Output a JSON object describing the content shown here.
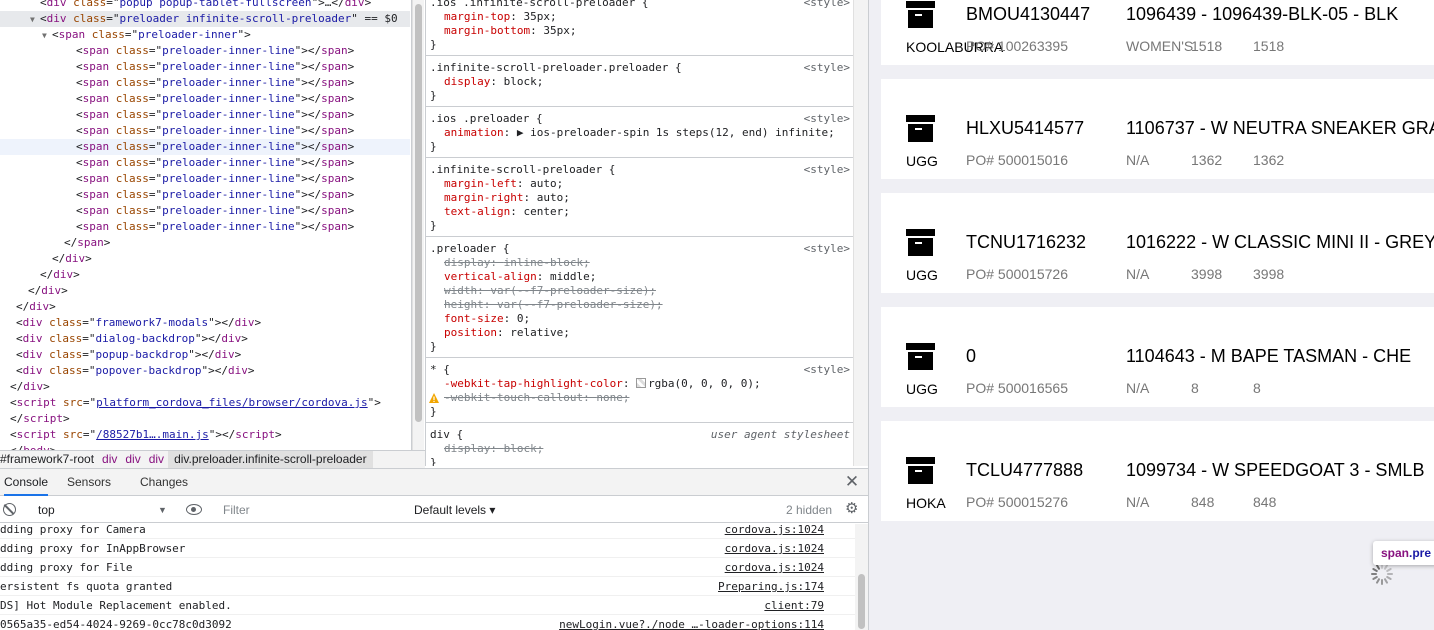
{
  "dom_tree": [
    {
      "indent": 40,
      "tri": "",
      "parts": [
        [
          "tx",
          "<"
        ],
        [
          "tg",
          "div"
        ],
        [
          "tx",
          " "
        ],
        [
          "an",
          "class"
        ],
        [
          "tx",
          "=\""
        ],
        [
          "av",
          "popup popup-tablet-fullscreen"
        ],
        [
          "tx",
          "\">…</"
        ],
        [
          "tg",
          "div"
        ],
        [
          "tx",
          ">"
        ]
      ]
    },
    {
      "indent": 40,
      "tri": "▼",
      "selected": true,
      "parts": [
        [
          "tx",
          "<"
        ],
        [
          "tg",
          "div"
        ],
        [
          "tx",
          " "
        ],
        [
          "an",
          "class"
        ],
        [
          "tx",
          "=\""
        ],
        [
          "av",
          "preloader infinite-scroll-preloader"
        ],
        [
          "tx",
          "\""
        ],
        [
          "tx",
          " == $0"
        ]
      ]
    },
    {
      "indent": 52,
      "tri": "▼",
      "parts": [
        [
          "tx",
          "<"
        ],
        [
          "tg",
          "span"
        ],
        [
          "tx",
          " "
        ],
        [
          "an",
          "class"
        ],
        [
          "tx",
          "=\""
        ],
        [
          "av",
          "preloader-inner"
        ],
        [
          "tx",
          "\">"
        ]
      ]
    },
    {
      "indent": 76,
      "tri": "",
      "parts": [
        [
          "tx",
          "<"
        ],
        [
          "tg",
          "span"
        ],
        [
          "tx",
          " "
        ],
        [
          "an",
          "class"
        ],
        [
          "tx",
          "=\""
        ],
        [
          "av",
          "preloader-inner-line"
        ],
        [
          "tx",
          "\"></"
        ],
        [
          "tg",
          "span"
        ],
        [
          "tx",
          ">"
        ]
      ]
    },
    {
      "indent": 76,
      "tri": "",
      "parts": [
        [
          "tx",
          "<"
        ],
        [
          "tg",
          "span"
        ],
        [
          "tx",
          " "
        ],
        [
          "an",
          "class"
        ],
        [
          "tx",
          "=\""
        ],
        [
          "av",
          "preloader-inner-line"
        ],
        [
          "tx",
          "\"></"
        ],
        [
          "tg",
          "span"
        ],
        [
          "tx",
          ">"
        ]
      ]
    },
    {
      "indent": 76,
      "tri": "",
      "parts": [
        [
          "tx",
          "<"
        ],
        [
          "tg",
          "span"
        ],
        [
          "tx",
          " "
        ],
        [
          "an",
          "class"
        ],
        [
          "tx",
          "=\""
        ],
        [
          "av",
          "preloader-inner-line"
        ],
        [
          "tx",
          "\"></"
        ],
        [
          "tg",
          "span"
        ],
        [
          "tx",
          ">"
        ]
      ]
    },
    {
      "indent": 76,
      "tri": "",
      "parts": [
        [
          "tx",
          "<"
        ],
        [
          "tg",
          "span"
        ],
        [
          "tx",
          " "
        ],
        [
          "an",
          "class"
        ],
        [
          "tx",
          "=\""
        ],
        [
          "av",
          "preloader-inner-line"
        ],
        [
          "tx",
          "\"></"
        ],
        [
          "tg",
          "span"
        ],
        [
          "tx",
          ">"
        ]
      ]
    },
    {
      "indent": 76,
      "tri": "",
      "parts": [
        [
          "tx",
          "<"
        ],
        [
          "tg",
          "span"
        ],
        [
          "tx",
          " "
        ],
        [
          "an",
          "class"
        ],
        [
          "tx",
          "=\""
        ],
        [
          "av",
          "preloader-inner-line"
        ],
        [
          "tx",
          "\"></"
        ],
        [
          "tg",
          "span"
        ],
        [
          "tx",
          ">"
        ]
      ]
    },
    {
      "indent": 76,
      "tri": "",
      "parts": [
        [
          "tx",
          "<"
        ],
        [
          "tg",
          "span"
        ],
        [
          "tx",
          " "
        ],
        [
          "an",
          "class"
        ],
        [
          "tx",
          "=\""
        ],
        [
          "av",
          "preloader-inner-line"
        ],
        [
          "tx",
          "\"></"
        ],
        [
          "tg",
          "span"
        ],
        [
          "tx",
          ">"
        ]
      ]
    },
    {
      "indent": 76,
      "tri": "",
      "hl": true,
      "parts": [
        [
          "tx",
          "<"
        ],
        [
          "tg",
          "span"
        ],
        [
          "tx",
          " "
        ],
        [
          "an",
          "class"
        ],
        [
          "tx",
          "=\""
        ],
        [
          "av",
          "preloader-inner-line"
        ],
        [
          "tx",
          "\"></"
        ],
        [
          "tg",
          "span"
        ],
        [
          "tx",
          ">"
        ]
      ]
    },
    {
      "indent": 76,
      "tri": "",
      "parts": [
        [
          "tx",
          "<"
        ],
        [
          "tg",
          "span"
        ],
        [
          "tx",
          " "
        ],
        [
          "an",
          "class"
        ],
        [
          "tx",
          "=\""
        ],
        [
          "av",
          "preloader-inner-line"
        ],
        [
          "tx",
          "\"></"
        ],
        [
          "tg",
          "span"
        ],
        [
          "tx",
          ">"
        ]
      ]
    },
    {
      "indent": 76,
      "tri": "",
      "parts": [
        [
          "tx",
          "<"
        ],
        [
          "tg",
          "span"
        ],
        [
          "tx",
          " "
        ],
        [
          "an",
          "class"
        ],
        [
          "tx",
          "=\""
        ],
        [
          "av",
          "preloader-inner-line"
        ],
        [
          "tx",
          "\"></"
        ],
        [
          "tg",
          "span"
        ],
        [
          "tx",
          ">"
        ]
      ]
    },
    {
      "indent": 76,
      "tri": "",
      "parts": [
        [
          "tx",
          "<"
        ],
        [
          "tg",
          "span"
        ],
        [
          "tx",
          " "
        ],
        [
          "an",
          "class"
        ],
        [
          "tx",
          "=\""
        ],
        [
          "av",
          "preloader-inner-line"
        ],
        [
          "tx",
          "\"></"
        ],
        [
          "tg",
          "span"
        ],
        [
          "tx",
          ">"
        ]
      ]
    },
    {
      "indent": 76,
      "tri": "",
      "parts": [
        [
          "tx",
          "<"
        ],
        [
          "tg",
          "span"
        ],
        [
          "tx",
          " "
        ],
        [
          "an",
          "class"
        ],
        [
          "tx",
          "=\""
        ],
        [
          "av",
          "preloader-inner-line"
        ],
        [
          "tx",
          "\"></"
        ],
        [
          "tg",
          "span"
        ],
        [
          "tx",
          ">"
        ]
      ]
    },
    {
      "indent": 76,
      "tri": "",
      "parts": [
        [
          "tx",
          "<"
        ],
        [
          "tg",
          "span"
        ],
        [
          "tx",
          " "
        ],
        [
          "an",
          "class"
        ],
        [
          "tx",
          "=\""
        ],
        [
          "av",
          "preloader-inner-line"
        ],
        [
          "tx",
          "\"></"
        ],
        [
          "tg",
          "span"
        ],
        [
          "tx",
          ">"
        ]
      ]
    },
    {
      "indent": 64,
      "tri": "",
      "parts": [
        [
          "tx",
          "</"
        ],
        [
          "tg",
          "span"
        ],
        [
          "tx",
          ">"
        ]
      ]
    },
    {
      "indent": 52,
      "tri": "",
      "parts": [
        [
          "tx",
          "</"
        ],
        [
          "tg",
          "div"
        ],
        [
          "tx",
          ">"
        ]
      ]
    },
    {
      "indent": 40,
      "tri": "",
      "parts": [
        [
          "tx",
          "</"
        ],
        [
          "tg",
          "div"
        ],
        [
          "tx",
          ">"
        ]
      ]
    },
    {
      "indent": 28,
      "tri": "",
      "parts": [
        [
          "tx",
          "</"
        ],
        [
          "tg",
          "div"
        ],
        [
          "tx",
          ">"
        ]
      ]
    },
    {
      "indent": 16,
      "tri": "",
      "parts": [
        [
          "tx",
          "</"
        ],
        [
          "tg",
          "div"
        ],
        [
          "tx",
          ">"
        ]
      ]
    },
    {
      "indent": 16,
      "tri": "",
      "parts": [
        [
          "tx",
          "<"
        ],
        [
          "tg",
          "div"
        ],
        [
          "tx",
          " "
        ],
        [
          "an",
          "class"
        ],
        [
          "tx",
          "=\""
        ],
        [
          "av",
          "framework7-modals"
        ],
        [
          "tx",
          "\"></"
        ],
        [
          "tg",
          "div"
        ],
        [
          "tx",
          ">"
        ]
      ]
    },
    {
      "indent": 16,
      "tri": "",
      "parts": [
        [
          "tx",
          "<"
        ],
        [
          "tg",
          "div"
        ],
        [
          "tx",
          " "
        ],
        [
          "an",
          "class"
        ],
        [
          "tx",
          "=\""
        ],
        [
          "av",
          "dialog-backdrop"
        ],
        [
          "tx",
          "\"></"
        ],
        [
          "tg",
          "div"
        ],
        [
          "tx",
          ">"
        ]
      ]
    },
    {
      "indent": 16,
      "tri": "",
      "parts": [
        [
          "tx",
          "<"
        ],
        [
          "tg",
          "div"
        ],
        [
          "tx",
          " "
        ],
        [
          "an",
          "class"
        ],
        [
          "tx",
          "=\""
        ],
        [
          "av",
          "popup-backdrop"
        ],
        [
          "tx",
          "\"></"
        ],
        [
          "tg",
          "div"
        ],
        [
          "tx",
          ">"
        ]
      ]
    },
    {
      "indent": 16,
      "tri": "",
      "parts": [
        [
          "tx",
          "<"
        ],
        [
          "tg",
          "div"
        ],
        [
          "tx",
          " "
        ],
        [
          "an",
          "class"
        ],
        [
          "tx",
          "=\""
        ],
        [
          "av",
          "popover-backdrop"
        ],
        [
          "tx",
          "\"></"
        ],
        [
          "tg",
          "div"
        ],
        [
          "tx",
          ">"
        ]
      ]
    },
    {
      "indent": 4,
      "tri": "",
      "parts": [
        [
          "tx",
          "</"
        ],
        [
          "tg",
          "div"
        ],
        [
          "tx",
          ">"
        ]
      ]
    },
    {
      "indent": 4,
      "tri": "",
      "parts": [
        [
          "tx",
          "<"
        ],
        [
          "tg",
          "script"
        ],
        [
          "tx",
          " "
        ],
        [
          "an",
          "src"
        ],
        [
          "tx",
          "=\""
        ],
        [
          "lk",
          "platform_cordova_files/browser/cordova.js"
        ],
        [
          "tx",
          "\">"
        ]
      ]
    },
    {
      "indent": 4,
      "tri": "",
      "parts": [
        [
          "tx",
          "</"
        ],
        [
          "tg",
          "script"
        ],
        [
          "tx",
          ">"
        ]
      ]
    },
    {
      "indent": 4,
      "tri": "",
      "parts": [
        [
          "tx",
          "<"
        ],
        [
          "tg",
          "script"
        ],
        [
          "tx",
          " "
        ],
        [
          "an",
          "src"
        ],
        [
          "tx",
          "=\""
        ],
        [
          "lk",
          "/88527b1….main.js"
        ],
        [
          "tx",
          "\"></"
        ],
        [
          "tg",
          "script"
        ],
        [
          "tx",
          ">"
        ]
      ]
    },
    {
      "indent": 4,
      "tri": "",
      "parts": [
        [
          "tx",
          "</"
        ],
        [
          "tg",
          "body"
        ],
        [
          "tx",
          ">"
        ]
      ]
    }
  ],
  "styles": [
    {
      "selector": ".ios .infinite-scroll-preloader {",
      "source": "<style>",
      "props": [
        {
          "name": "margin-top",
          "value": "35px;",
          "struck": false
        },
        {
          "name": "margin-bottom",
          "value": "35px;",
          "struck": false
        }
      ]
    },
    {
      "selector": ".infinite-scroll-preloader.preloader {",
      "source": "<style>",
      "props": [
        {
          "name": "display",
          "value": "block;",
          "struck": false
        }
      ]
    },
    {
      "selector": ".ios .preloader {",
      "source": "<style>",
      "props": [
        {
          "name": "animation",
          "value": "▶ ios-preloader-spin 1s steps(12, end) infinite;",
          "struck": false
        }
      ]
    },
    {
      "selector": ".infinite-scroll-preloader {",
      "source": "<style>",
      "props": [
        {
          "name": "margin-left",
          "value": "auto;",
          "struck": false
        },
        {
          "name": "margin-right",
          "value": "auto;",
          "struck": false
        },
        {
          "name": "text-align",
          "value": "center;",
          "struck": false
        }
      ]
    },
    {
      "selector": ".preloader {",
      "source": "<style>",
      "props": [
        {
          "name": "display",
          "value": "inline-block;",
          "struck": true
        },
        {
          "name": "vertical-align",
          "value": "middle;",
          "struck": false
        },
        {
          "name": "width",
          "value": "var(--f7-preloader-size);",
          "struck": true
        },
        {
          "name": "height",
          "value": "var(--f7-preloader-size);",
          "struck": true
        },
        {
          "name": "font-size",
          "value": "0;",
          "struck": false
        },
        {
          "name": "position",
          "value": "relative;",
          "struck": false
        }
      ]
    },
    {
      "selector": "* {",
      "source": "<style>",
      "props": [
        {
          "name": "-webkit-tap-highlight-color",
          "value": "rgba(0, 0, 0, 0);",
          "struck": false,
          "swatch": true
        },
        {
          "name": "-webkit-touch-callout",
          "value": "none;",
          "struck": true,
          "warn": true
        }
      ]
    },
    {
      "selector": "div {",
      "source": "user agent stylesheet",
      "ua": true,
      "props": [
        {
          "name": "display",
          "value": "block;",
          "struck": true
        }
      ]
    }
  ],
  "breadcrumbs": [
    "#framework7-root",
    "div",
    "div",
    "div",
    "div.preloader.infinite-scroll-preloader"
  ],
  "drawer": {
    "tabs": [
      "Console",
      "Sensors",
      "Changes"
    ],
    "context": "top",
    "filter_placeholder": "Filter",
    "levels": "Default levels ▾",
    "hidden": "2 hidden"
  },
  "console_logs": [
    {
      "msg": "dding proxy for Camera",
      "loc": "cordova.js:1024"
    },
    {
      "msg": "dding proxy for InAppBrowser",
      "loc": "cordova.js:1024"
    },
    {
      "msg": "dding proxy for File",
      "loc": "cordova.js:1024"
    },
    {
      "msg": "ersistent fs quota granted",
      "loc": "Preparing.js:174"
    },
    {
      "msg": "DS] Hot Module Replacement enabled.",
      "loc": "client:79"
    },
    {
      "msg": "0565a35-ed54-4024-9269-0cc78c0d3092",
      "loc": "newLogin.vue?./node_…-loader-options:114"
    }
  ],
  "cards": [
    {
      "container": "BMOU4130447",
      "product": "1096439 - 1096439-BLK-05 - BLK",
      "brand": "KOOLABURRA",
      "po": "PO# 100263395",
      "dept": "WOMEN'S",
      "qty1": "1518",
      "qty2": "1518"
    },
    {
      "container": "HLXU5414577",
      "product": "1106737 - W NEUTRA SNEAKER GRAF",
      "brand": "UGG",
      "po": "PO# 500015016",
      "dept": "N/A",
      "qty1": "1362",
      "qty2": "1362"
    },
    {
      "container": "TCNU1716232",
      "product": "1016222 - W CLASSIC MINI II - GREY",
      "brand": "UGG",
      "po": "PO# 500015726",
      "dept": "N/A",
      "qty1": "3998",
      "qty2": "3998"
    },
    {
      "container": "0",
      "product": "1104643 - M BAPE TASMAN - CHE",
      "brand": "UGG",
      "po": "PO# 500016565",
      "dept": "N/A",
      "qty1": "8",
      "qty2": "8"
    },
    {
      "container": "TCLU4777888",
      "product": "1099734 - W SPEEDGOAT 3 - SMLB",
      "brand": "HOKA",
      "po": "PO# 500015276",
      "dept": "N/A",
      "qty1": "848",
      "qty2": "848"
    }
  ],
  "tooltip": {
    "tag": "span",
    "cls": ".pre"
  }
}
